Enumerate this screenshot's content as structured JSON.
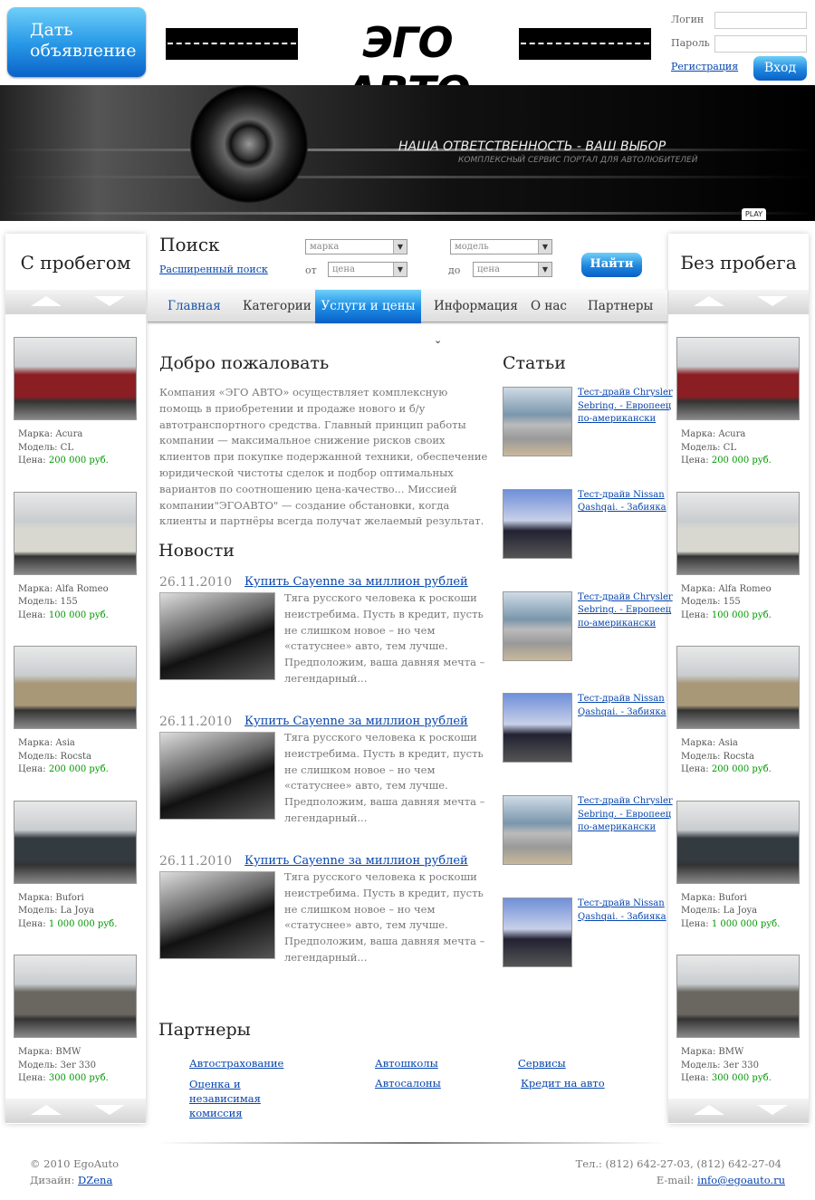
{
  "header": {
    "post_ad_button": "Дать объявление",
    "logo": "ЭГО АВТО",
    "login_label": "Логин",
    "password_label": "Пароль",
    "login_value": "",
    "password_value": "",
    "register_link": "Регистрация",
    "login_button": "Вход"
  },
  "banner": {
    "slogan": "НАША  ОТВЕТСТВЕННОСТЬ -  ВАШ ВЫБОР",
    "subslogan": "КОМПЛЕКСНЫЙ СЕРВИС ПОРТАЛ ДЛЯ АВТОЛЮБИТЕЛЕЙ",
    "play": "PLAY"
  },
  "search": {
    "title": "Поиск",
    "advanced_link": "Расширенный поиск",
    "make": "марка",
    "model": "модель",
    "from_label": "от",
    "to_label": "до",
    "price_from": "цена",
    "price_to": "цена",
    "find_button": "Найти"
  },
  "nav": [
    {
      "label": "Главная",
      "active": false
    },
    {
      "label": "Категории",
      "dropdown": true
    },
    {
      "label": "Услуги и цены",
      "active": true
    },
    {
      "label": "Информация",
      "dropdown": true
    },
    {
      "label": "О нас"
    },
    {
      "label": "Партнеры"
    }
  ],
  "left_sidebar": {
    "title": "С пробегом"
  },
  "right_sidebar": {
    "title": "Без пробега"
  },
  "cars": [
    {
      "make": "Марка: Acura",
      "model": "Модель: CL",
      "price_label": "Цена: ",
      "price": "200 000 руб.",
      "color": "#8b1e22"
    },
    {
      "make": "Марка: Alfa Romeo",
      "model": "Модель: 155",
      "price_label": "Цена: ",
      "price": "100 000 руб.",
      "color": "#d8d8d0"
    },
    {
      "make": "Марка: Asia",
      "model": "Модель: Rocsta",
      "price_label": "Цена: ",
      "price": "200 000 руб.",
      "color": "#a89878"
    },
    {
      "make": "Марка: Bufori",
      "model": "Модель: La Joya",
      "price_label": "Цена: ",
      "price": "1 000 000 руб.",
      "color": "#333a40"
    },
    {
      "make": "Марка: BMW",
      "model": "Модель: 3er 330",
      "price_label": "Цена: ",
      "price": "300 000 руб.",
      "color": "#6a6660"
    }
  ],
  "welcome": {
    "title": "Добро пожаловать",
    "text": "Компания «ЭГО АВТО» осуществляет комплексную помощь в приобретении и продаже нового и б/у автотранспортного средства. Главный принцип работы компании — максимальное снижение рисков своих клиентов при покупке подержанной техники, обеспечение юридической чистоты сделок и подбор оптимальных вариантов по соотношению цена-качество... Миссией компании\"ЭГОАВТО\" — создание обстановки, когда клиенты и партнёры всегда получат желаемый результат."
  },
  "news": {
    "title": "Новости",
    "items": [
      {
        "date": "26.11.2010",
        "title": "Купить Cayenne за миллион рублей",
        "text": "Тяга русского человека к роскоши неистребима. Пусть в кредит, пусть не слишком новое – но чем «статуснее» авто, тем лучше. Предположим, ваша давняя мечта – легендарный..."
      },
      {
        "date": "26.11.2010",
        "title": "Купить Cayenne за миллион рублей",
        "text": "Тяга русского человека к роскоши неистребима. Пусть в кредит, пусть не слишком новое – но чем «статуснее» авто, тем лучше. Предположим, ваша давняя мечта – легендарный..."
      },
      {
        "date": "26.11.2010",
        "title": "Купить Cayenne за миллион рублей",
        "text": "Тяга русского человека к роскоши неистребима. Пусть в кредит, пусть не слишком новое – но чем «статуснее» авто, тем лучше. Предположим, ваша давняя мечта – легендарный..."
      }
    ]
  },
  "articles": {
    "title": "Статьи",
    "items": [
      {
        "lines": [
          "Тест-драйв Chrysler",
          "Sebring. - Европеец",
          "по-американски"
        ]
      },
      {
        "lines": [
          "Тест-драйв Nissan",
          "Qashqai. - Забияка"
        ]
      },
      {
        "lines": [
          "Тест-драйв Chrysler",
          "Sebring. - Европеец",
          "по-американски"
        ]
      },
      {
        "lines": [
          "Тест-драйв Nissan",
          "Qashqai. - Забияка"
        ]
      },
      {
        "lines": [
          "Тест-драйв Chrysler",
          "Sebring. - Европеец",
          "по-американски"
        ]
      },
      {
        "lines": [
          "Тест-драйв Nissan",
          "Qashqai. - Забияка"
        ]
      }
    ]
  },
  "partners": {
    "title": "Партнеры",
    "links": [
      "Автострахование",
      "Автошколы",
      "Сервисы",
      "Оценка и независимая комиссия",
      "Автосалоны",
      "Кредит на авто"
    ]
  },
  "footer": {
    "copyright": "© 2010 EgoAuto",
    "design_label": "Дизайн: ",
    "design_link": "DZena",
    "phones": "Тел.: (812) 642-27-03, (812) 642-27-04",
    "email_label": "E-mail: ",
    "email": "info@egoauto.ru"
  },
  "colors": {
    "accent": "#1e86de",
    "link": "#0645ad",
    "price": "#009900"
  }
}
